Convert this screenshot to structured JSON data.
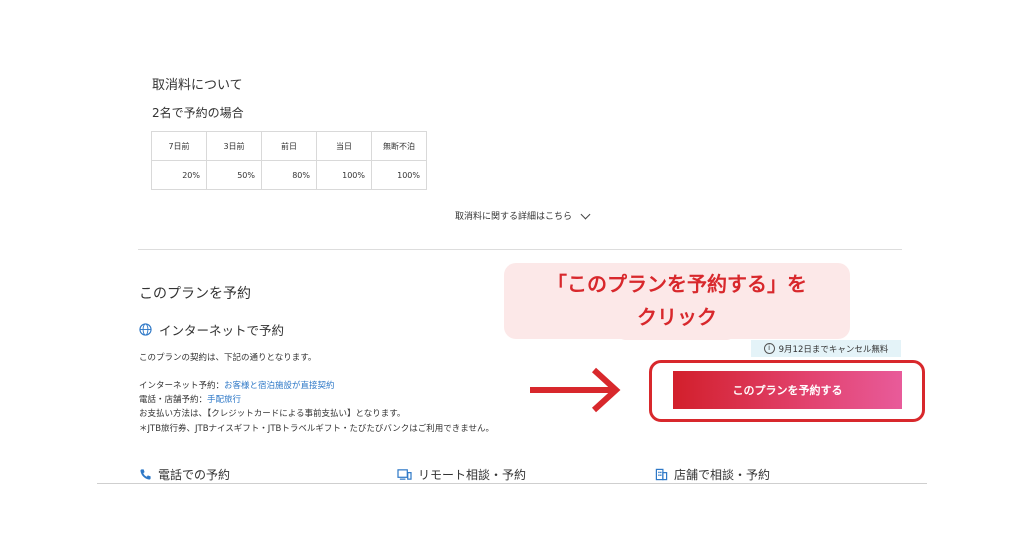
{
  "cancellation": {
    "title": "取消料について",
    "subtitle": "2名で予約の場合",
    "headers": [
      "7日前",
      "3日前",
      "前日",
      "当日",
      "無断不泊"
    ],
    "values": [
      "20%",
      "50%",
      "80%",
      "100%",
      "100%"
    ],
    "detail_link": "取消料に関する詳細はこちら"
  },
  "plan": {
    "title": "このプランを予約",
    "internet_heading": "インターネットで予約",
    "intro": "このプランの契約は、下記の通りとなります。",
    "internet_label": "インターネット予約：",
    "internet_link": "お客様と宿泊施設が直接契約",
    "phone_label": "電話・店舗予約：",
    "phone_link": "手配旅行",
    "payment": "お支払い方法は、【クレジットカードによる事前支払い】となります。",
    "notice": "＊JTB旅行券、JTBナイスギフト・JTBトラベルギフト・たびたびバンクはご利用できません。",
    "cancel_badge": "9月12日までキャンセル無料",
    "reserve_button": "このプランを予約する"
  },
  "annotation": {
    "line1": "「このプランを予約する」を",
    "line2": "クリック"
  },
  "bottom": {
    "phone": "電話での予約",
    "remote": "リモート相談・予約",
    "store": "店舗で相談・予約"
  },
  "colors": {
    "accent": "#d8282c",
    "link": "#2e78c7",
    "badge_bg": "#e4f3f8",
    "annotation_bg": "#fce8e8"
  }
}
